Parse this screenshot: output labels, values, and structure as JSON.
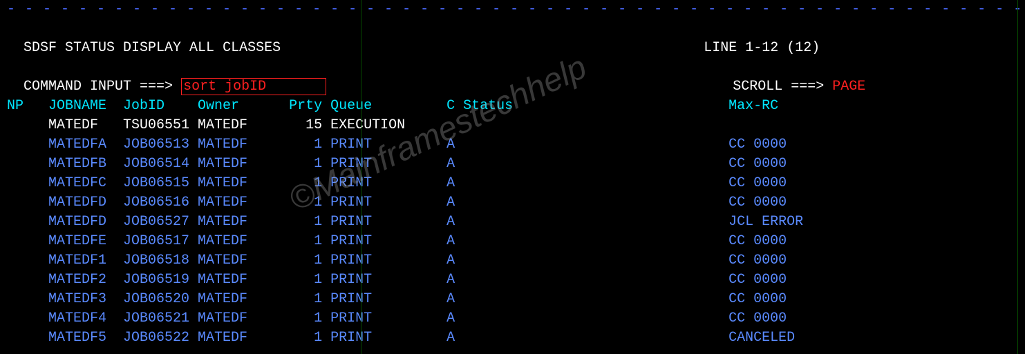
{
  "dash_line": "- - - - - - - - - - - - - - - - - - - - - - - - - - - - - - - - - - - - - - - - - - - - - - - - - - - - - - - - - - - - -",
  "title": "SDSF STATUS DISPLAY ALL CLASSES",
  "line_info": "LINE 1-12 (12)",
  "cmd_label": "COMMAND INPUT ===>",
  "cmd_value": "sort jobID",
  "scroll_label": "SCROLL ===>",
  "scroll_value": "PAGE",
  "headers": {
    "np": "NP",
    "jobname": "JOBNAME",
    "jobid": "JobID",
    "owner": "Owner",
    "prty": "Prty",
    "queue": "Queue",
    "c": "C",
    "status": "Status",
    "maxrc": "Max-RC"
  },
  "rows": [
    {
      "np": "",
      "jobname": "MATEDF",
      "jobid": "TSU06551",
      "owner": "MATEDF",
      "prty": "15",
      "queue": "EXECUTION",
      "c": "",
      "status": "",
      "maxrc": "",
      "style": "white"
    },
    {
      "np": "",
      "jobname": "MATEDFA",
      "jobid": "JOB06513",
      "owner": "MATEDF",
      "prty": "1",
      "queue": "PRINT",
      "c": "A",
      "status": "",
      "maxrc": "CC 0000",
      "style": "blue"
    },
    {
      "np": "",
      "jobname": "MATEDFB",
      "jobid": "JOB06514",
      "owner": "MATEDF",
      "prty": "1",
      "queue": "PRINT",
      "c": "A",
      "status": "",
      "maxrc": "CC 0000",
      "style": "blue"
    },
    {
      "np": "",
      "jobname": "MATEDFC",
      "jobid": "JOB06515",
      "owner": "MATEDF",
      "prty": "1",
      "queue": "PRINT",
      "c": "A",
      "status": "",
      "maxrc": "CC 0000",
      "style": "blue"
    },
    {
      "np": "",
      "jobname": "MATEDFD",
      "jobid": "JOB06516",
      "owner": "MATEDF",
      "prty": "1",
      "queue": "PRINT",
      "c": "A",
      "status": "",
      "maxrc": "CC 0000",
      "style": "blue"
    },
    {
      "np": "",
      "jobname": "MATEDFD",
      "jobid": "JOB06527",
      "owner": "MATEDF",
      "prty": "1",
      "queue": "PRINT",
      "c": "A",
      "status": "",
      "maxrc": "JCL ERROR",
      "style": "blue"
    },
    {
      "np": "",
      "jobname": "MATEDFE",
      "jobid": "JOB06517",
      "owner": "MATEDF",
      "prty": "1",
      "queue": "PRINT",
      "c": "A",
      "status": "",
      "maxrc": "CC 0000",
      "style": "blue"
    },
    {
      "np": "",
      "jobname": "MATEDF1",
      "jobid": "JOB06518",
      "owner": "MATEDF",
      "prty": "1",
      "queue": "PRINT",
      "c": "A",
      "status": "",
      "maxrc": "CC 0000",
      "style": "blue"
    },
    {
      "np": "",
      "jobname": "MATEDF2",
      "jobid": "JOB06519",
      "owner": "MATEDF",
      "prty": "1",
      "queue": "PRINT",
      "c": "A",
      "status": "",
      "maxrc": "CC 0000",
      "style": "blue"
    },
    {
      "np": "",
      "jobname": "MATEDF3",
      "jobid": "JOB06520",
      "owner": "MATEDF",
      "prty": "1",
      "queue": "PRINT",
      "c": "A",
      "status": "",
      "maxrc": "CC 0000",
      "style": "blue"
    },
    {
      "np": "",
      "jobname": "MATEDF4",
      "jobid": "JOB06521",
      "owner": "MATEDF",
      "prty": "1",
      "queue": "PRINT",
      "c": "A",
      "status": "",
      "maxrc": "CC 0000",
      "style": "blue"
    },
    {
      "np": "",
      "jobname": "MATEDF5",
      "jobid": "JOB06522",
      "owner": "MATEDF",
      "prty": "1",
      "queue": "PRINT",
      "c": "A",
      "status": "",
      "maxrc": "CANCELED",
      "style": "blue"
    }
  ],
  "watermark": "©Mainframestechhelp"
}
